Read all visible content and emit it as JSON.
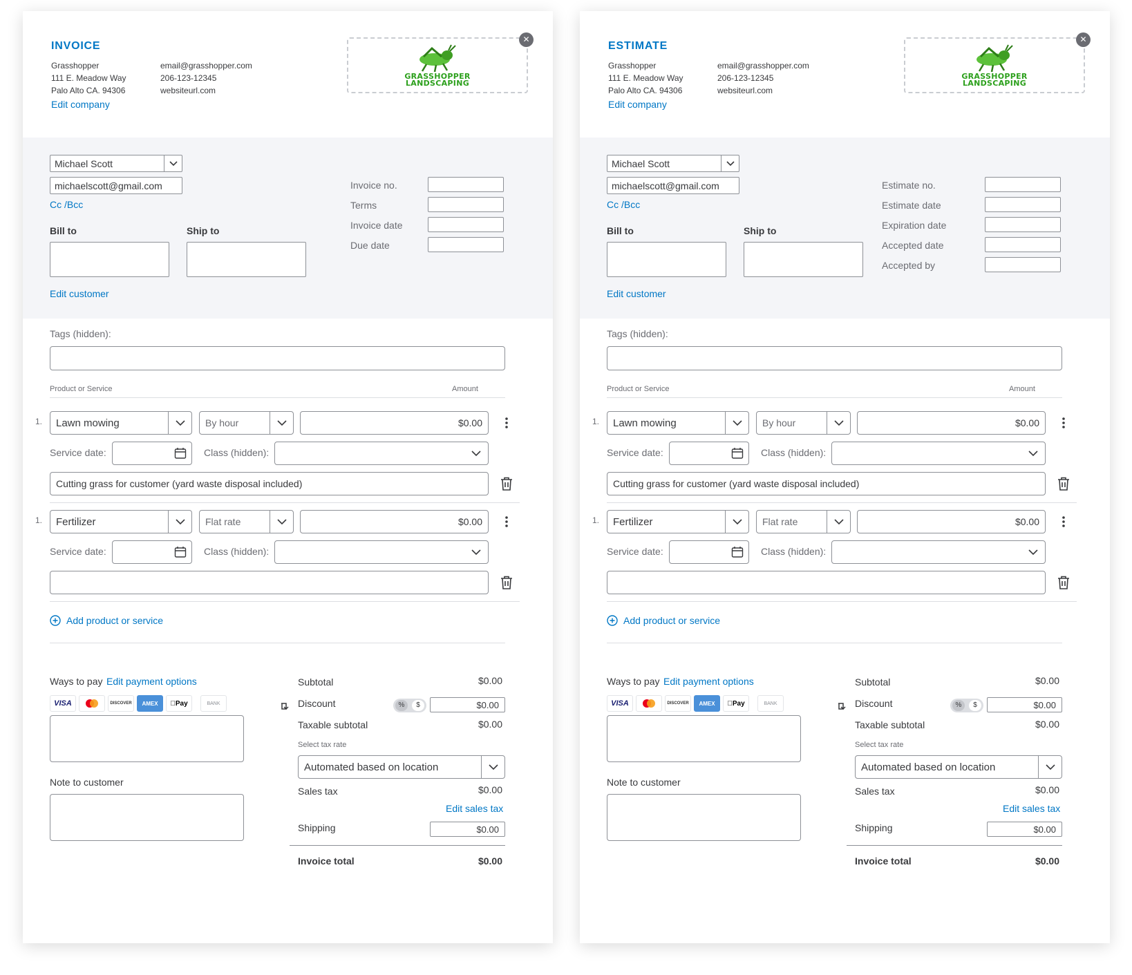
{
  "invoice": {
    "title": "INVOICE",
    "company": {
      "name": "Grasshopper",
      "address1": "111 E. Meadow Way",
      "address2": "Palo Alto CA. 94306",
      "email": "email@grasshopper.com",
      "phone": "206-123-12345",
      "website": "websiteurl.com",
      "edit_link": "Edit company",
      "logo_line1": "GRASSHOPPER",
      "logo_line2": "LANDSCAPING"
    },
    "customer": {
      "name": "Michael Scott",
      "email": "michaelscott@gmail.com",
      "cc_bcc": "Cc /Bcc",
      "bill_to": "Bill to",
      "ship_to": "Ship to",
      "edit_link": "Edit customer"
    },
    "meta_fields": [
      "Invoice no.",
      "Terms",
      "Invoice date",
      "Due date"
    ],
    "tags_label": "Tags (hidden):",
    "table": {
      "product_header": "Product or Service",
      "amount_header": "Amount"
    },
    "lines": [
      {
        "num": "1.",
        "product": "Lawn mowing",
        "rate": "By hour",
        "amount": "$0.00",
        "service_date_label": "Service date:",
        "class_label": "Class (hidden):",
        "description": "Cutting grass for customer (yard waste disposal included)"
      },
      {
        "num": "1.",
        "product": "Fertilizer",
        "rate": "Flat rate",
        "amount": "$0.00",
        "service_date_label": "Service date:",
        "class_label": "Class (hidden):",
        "description": ""
      }
    ],
    "add_line": "Add product or service",
    "payment": {
      "ways_label": "Ways to pay",
      "edit_link": "Edit payment options",
      "cards": [
        "VISA",
        "mastercard",
        "DISCOVER",
        "AMEX",
        "Pay",
        "BANK"
      ],
      "note_label": "Note to customer"
    },
    "totals": {
      "subtotal_label": "Subtotal",
      "subtotal": "$0.00",
      "discount_label": "Discount",
      "discount": "$0.00",
      "pct": "%",
      "dollar": "$",
      "taxable_label": "Taxable subtotal",
      "taxable": "$0.00",
      "tax_rate_label": "Select tax rate",
      "tax_rate": "Automated based on location",
      "sales_tax_label": "Sales tax",
      "sales_tax": "$0.00",
      "edit_sales_tax": "Edit sales tax",
      "shipping_label": "Shipping",
      "shipping": "$0.00",
      "total_label": "Invoice total",
      "total": "$0.00"
    }
  },
  "estimate": {
    "title": "ESTIMATE",
    "company": {
      "name": "Grasshopper",
      "address1": "111 E. Meadow Way",
      "address2": "Palo Alto CA. 94306",
      "email": "email@grasshopper.com",
      "phone": "206-123-12345",
      "website": "websiteurl.com",
      "edit_link": "Edit company",
      "logo_line1": "GRASSHOPPER",
      "logo_line2": "LANDSCAPING"
    },
    "customer": {
      "name": "Michael Scott",
      "email": "michaelscott@gmail.com",
      "cc_bcc": "Cc /Bcc",
      "bill_to": "Bill to",
      "ship_to": "Ship to",
      "edit_link": "Edit customer"
    },
    "meta_fields": [
      "Estimate no.",
      "Estimate date",
      "Expiration date",
      "Accepted date",
      "Accepted by"
    ],
    "tags_label": "Tags (hidden):",
    "table": {
      "product_header": "Product or Service",
      "amount_header": "Amount"
    },
    "lines": [
      {
        "num": "1.",
        "product": "Lawn mowing",
        "rate": "By hour",
        "amount": "$0.00",
        "service_date_label": "Service date:",
        "class_label": "Class (hidden):",
        "description": "Cutting grass for customer (yard waste disposal included)"
      },
      {
        "num": "1.",
        "product": "Fertilizer",
        "rate": "Flat rate",
        "amount": "$0.00",
        "service_date_label": "Service date:",
        "class_label": "Class (hidden):",
        "description": ""
      }
    ],
    "add_line": "Add product or service",
    "payment": {
      "ways_label": "Ways to pay",
      "edit_link": "Edit payment options",
      "cards": [
        "VISA",
        "mastercard",
        "DISCOVER",
        "AMEX",
        "Pay",
        "BANK"
      ],
      "note_label": "Note to customer"
    },
    "totals": {
      "subtotal_label": "Subtotal",
      "subtotal": "$0.00",
      "discount_label": "Discount",
      "discount": "$0.00",
      "pct": "%",
      "dollar": "$",
      "taxable_label": "Taxable subtotal",
      "taxable": "$0.00",
      "tax_rate_label": "Select tax rate",
      "tax_rate": "Automated based on location",
      "sales_tax_label": "Sales tax",
      "sales_tax": "$0.00",
      "edit_sales_tax": "Edit sales tax",
      "shipping_label": "Shipping",
      "shipping": "$0.00",
      "total_label": "Invoice total",
      "total": "$0.00"
    }
  },
  "colors": {
    "accent": "#0077c5",
    "brand_green": "#2ca01c",
    "panel_gray": "#f4f5f8"
  }
}
